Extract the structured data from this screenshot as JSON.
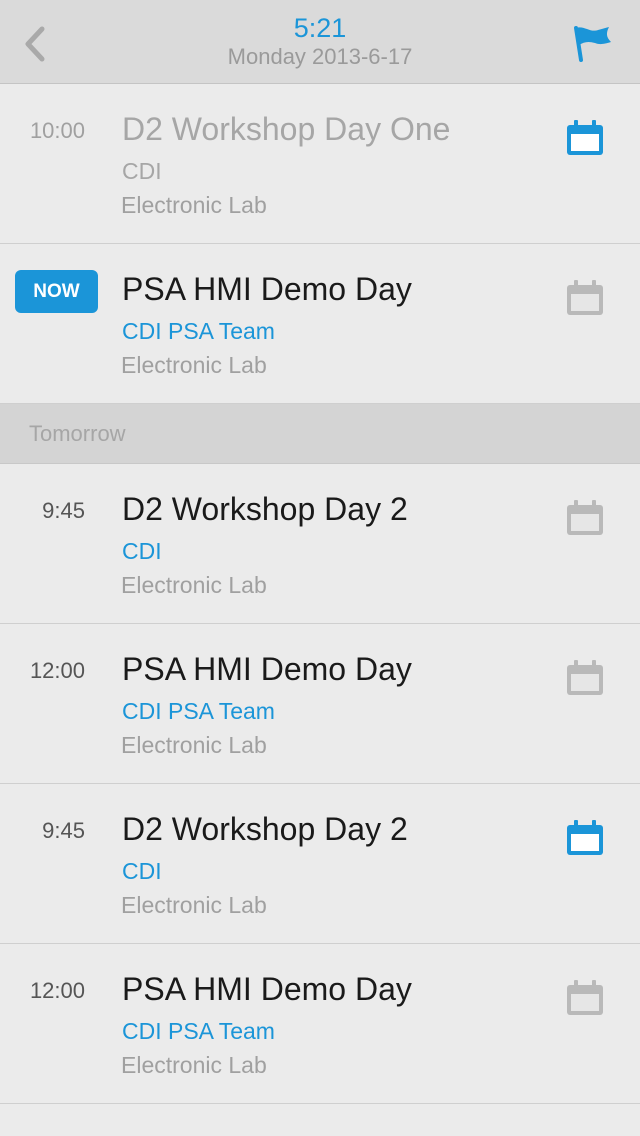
{
  "header": {
    "time": "5:21",
    "date": "Monday 2013-6-17"
  },
  "colors": {
    "accent": "#1b95d8",
    "inactive_icon": "#b9b9b9"
  },
  "today": [
    {
      "time": "10:00",
      "title": "D2 Workshop Day One",
      "org": "CDI",
      "location": "Electronic Lab",
      "state": "past",
      "calendar_icon": "calendar-icon",
      "calendar_active": true
    },
    {
      "badge": "NOW",
      "title": "PSA HMI Demo Day",
      "org": "CDI PSA Team",
      "location": "Electronic Lab",
      "state": "now",
      "calendar_icon": "calendar-icon",
      "calendar_active": false
    }
  ],
  "section_label": "Tomorrow",
  "tomorrow": [
    {
      "time": "9:45",
      "title": "D2 Workshop Day 2",
      "org": "CDI",
      "location": "Electronic Lab",
      "calendar_icon": "calendar-icon",
      "calendar_active": false
    },
    {
      "time": "12:00",
      "title": "PSA HMI Demo Day",
      "org": "CDI PSA Team",
      "location": "Electronic Lab",
      "calendar_icon": "calendar-icon",
      "calendar_active": false
    },
    {
      "time": "9:45",
      "title": "D2 Workshop Day 2",
      "org": "CDI",
      "location": "Electronic Lab",
      "calendar_icon": "calendar-icon",
      "calendar_active": true
    },
    {
      "time": "12:00",
      "title": "PSA HMI Demo Day",
      "org": "CDI PSA Team",
      "location": "Electronic Lab",
      "calendar_icon": "calendar-icon",
      "calendar_active": false
    }
  ]
}
